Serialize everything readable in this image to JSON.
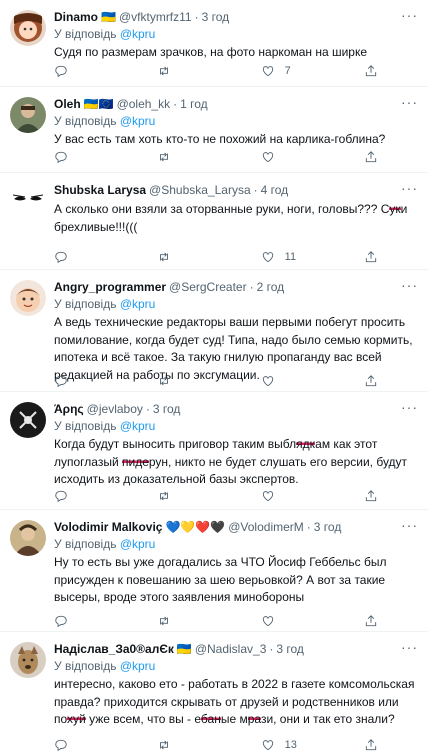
{
  "reply_prefix": "У відповідь",
  "tweets": [
    {
      "name": "Dinamo",
      "flag": "🇺🇦",
      "handle": "@vfktymrfz11",
      "sep": "·",
      "time": "3 год",
      "reply_to": "@kpru",
      "text": "Судя по размерам зрачков, на фото наркоман на ширке",
      "likes": "7"
    },
    {
      "name": "Oleh",
      "flag": "🇺🇦🇪🇺",
      "handle": "@oleh_kk",
      "sep": "·",
      "time": "1 год",
      "reply_to": "@kpru",
      "text": "У вас есть там хоть кто-то не похожий на карлика-гоблина?",
      "likes": ""
    },
    {
      "name": "Shubska Larysa",
      "flag": "",
      "handle": "@Shubska_Larysa",
      "sep": "·",
      "time": "4 год",
      "reply_to": "",
      "text_a": "А сколько они взяли за оторванные руки, ноги, головы??? С",
      "text_red": "ук",
      "text_b": "и брехливые!!!(((",
      "likes": "11"
    },
    {
      "name": "Angry_programmer",
      "flag": "",
      "handle": "@SergCreater",
      "sep": "·",
      "time": "2 год",
      "reply_to": "@kpru",
      "text": "А ведь технические редакторы ваши первыми побегут просить помилование, когда будет суд! Типа, надо было семью кормить, ипотека и всё такое. За такую гнилую пропаганду вас всей редакцией на работы по эксгумации.",
      "likes": ""
    },
    {
      "name": "Άρης",
      "flag": "",
      "handle": "@jevlaboy",
      "sep": "·",
      "time": "3 год",
      "reply_to": "@kpru",
      "text_a": "Когда будут выносить приговор таким выбл",
      "text_red": "ядк",
      "text_b": "ам как этот лупоглазый ",
      "text_red2": "пиде",
      "text_c": "рун, никто не будет слушать его версии, будут исходить из доказательной базы экспертов.",
      "likes": ""
    },
    {
      "name": "Volodimir Malkoviç",
      "flag": "💙💛❤️🖤",
      "handle": "@VolodimerM",
      "sep": "·",
      "time": "3 год",
      "reply_to": "@kpru",
      "text": "Ну то есть вы уже догадались за ЧТО Йосиф Геббельс был присужден к повешанию за шею верьовкой? А вот за такие высеры, вроде этого заявления минобороны",
      "likes": ""
    },
    {
      "name": "Надіслав_За0®алЄк",
      "flag": "🇺🇦",
      "handle": "@Nadislav_3",
      "sep": "·",
      "time": "3 год",
      "reply_to": "@kpru",
      "text_a": "интересно, каково ето - работать в 2022 в газете комсомольская правда? приходится скрывать от друзей и родственников или по",
      "text_red": "хуй",
      "text_b": " уже всем, что вы - е",
      "text_red2": "бан",
      "text_c": "ые м",
      "text_red3": "ра",
      "text_d": "зи, они и так ето знали?",
      "likes": "13"
    }
  ],
  "colors": {
    "accent": "#1d9bf0",
    "muted": "#536471",
    "text": "#0f1419"
  },
  "icons": [
    "more-icon",
    "reply-icon",
    "retweet-icon",
    "like-icon",
    "share-icon"
  ]
}
